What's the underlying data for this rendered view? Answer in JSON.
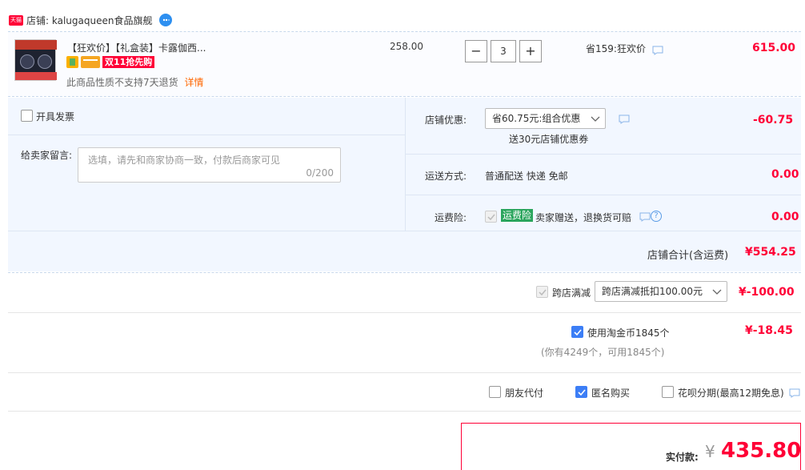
{
  "shop": {
    "badge_label": "天猫",
    "label": "店铺: kalugaqueen食品旗舰",
    "chat_icon": "chat-bubble-icon"
  },
  "item": {
    "title": "【狂欢价】【礼盒装】卡露伽西...",
    "promo_tag": "双11抢先购",
    "note": "此商品性质不支持7天退货",
    "detail_link": "详情",
    "unit_price": "258.00",
    "quantity": "3",
    "minus": "−",
    "plus": "+",
    "discount_note": "省159:狂欢价",
    "total": "615.00"
  },
  "invoice": {
    "label": "开具发票"
  },
  "message": {
    "label": "给卖家留言:",
    "placeholder": "选填，请先和商家协商一致，付款后商家可见",
    "counter": "0/200"
  },
  "shop_discount": {
    "label": "店铺优惠:",
    "selected": "省60.75元:组合优惠",
    "sub": "送30元店铺优惠券",
    "amount": "-60.75"
  },
  "shipping": {
    "label": "运送方式:",
    "value": "普通配送 快递 免邮",
    "amount": "0.00"
  },
  "insurance": {
    "label": "运费险:",
    "tag": "运费险",
    "text": "卖家赠送，退换货可赔",
    "amount": "0.00"
  },
  "shop_total": {
    "label": "店铺合计(含运费)",
    "amount": "¥554.25"
  },
  "cross_store": {
    "label": "跨店满减",
    "selected": "跨店满减抵扣100.00元",
    "amount": "¥-100.00"
  },
  "taojinbi": {
    "label": "使用淘金币1845个",
    "sub": "(你有4249个，可用1845个)",
    "amount": "¥-18.45"
  },
  "options": {
    "friend_pay": "朋友代付",
    "anonymous": "匿名购买",
    "huabei": "花呗分期(最高12期免息)"
  },
  "pay": {
    "label": "实付款:",
    "currency": "¥",
    "amount": "435.80"
  },
  "colors": {
    "accent_red": "#ff0036",
    "light_blue_bg": "#f2f7ff",
    "checkbox_blue": "#3c7ef6"
  }
}
